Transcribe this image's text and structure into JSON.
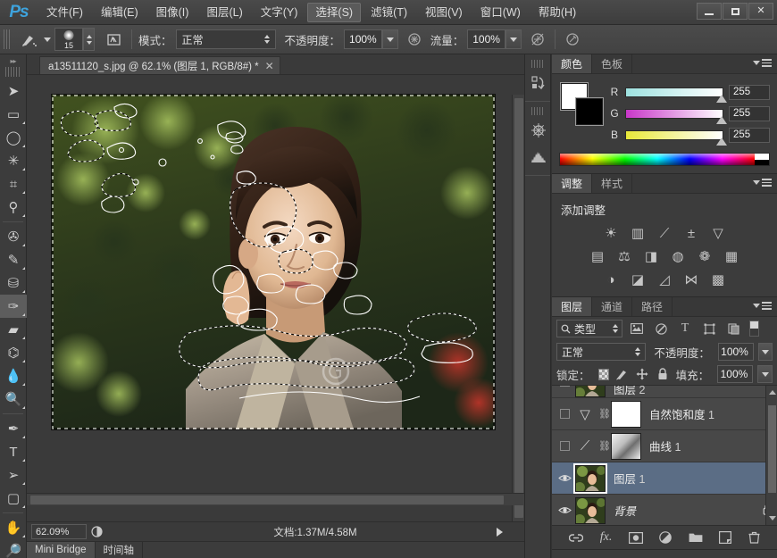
{
  "app": {
    "logo": "Ps",
    "menus": [
      {
        "label": "文件(F)",
        "active": false
      },
      {
        "label": "编辑(E)",
        "active": false
      },
      {
        "label": "图像(I)",
        "active": false
      },
      {
        "label": "图层(L)",
        "active": false
      },
      {
        "label": "文字(Y)",
        "active": false
      },
      {
        "label": "选择(S)",
        "active": true
      },
      {
        "label": "滤镜(T)",
        "active": false
      },
      {
        "label": "视图(V)",
        "active": false
      },
      {
        "label": "窗口(W)",
        "active": false
      },
      {
        "label": "帮助(H)",
        "active": false
      }
    ],
    "window_controls": {
      "minimize": "minimize-icon",
      "maximize": "maximize-icon",
      "close": "✕"
    }
  },
  "options_bar": {
    "tool_icon": "history-brush-icon",
    "brush_size": "15",
    "brush_panel_icon": "brush-panel-icon",
    "mode_label": "模式：",
    "mode_value": "正常",
    "opacity_label": "不透明度：",
    "opacity_value": "100%",
    "opacity_pressure_icon": "pressure-opacity-icon",
    "flow_label": "流量：",
    "flow_value": "100%",
    "airbrush_icon": "airbrush-icon",
    "flow_pressure_icon": "pressure-flow-icon"
  },
  "toolbar": {
    "collapse_icon": "double-chevron-right-icon",
    "groups": [
      [
        {
          "name": "move-tool",
          "glyph": "➤",
          "selected": false,
          "corner": false
        },
        {
          "name": "rectangular-marquee-tool",
          "glyph": "▭",
          "selected": false,
          "corner": true
        },
        {
          "name": "lasso-tool",
          "glyph": "◯",
          "selected": false,
          "corner": true
        },
        {
          "name": "magic-wand-tool",
          "glyph": "✳",
          "selected": false,
          "corner": true
        },
        {
          "name": "crop-tool",
          "glyph": "⌗",
          "selected": false,
          "corner": true
        },
        {
          "name": "eyedropper-tool",
          "glyph": "⚲",
          "selected": false,
          "corner": true
        }
      ],
      [
        {
          "name": "spot-healing-brush-tool",
          "glyph": "✇",
          "selected": false,
          "corner": true
        },
        {
          "name": "brush-tool",
          "glyph": "✎",
          "selected": false,
          "corner": true
        },
        {
          "name": "clone-stamp-tool",
          "glyph": "⛁",
          "selected": false,
          "corner": true
        },
        {
          "name": "history-brush-tool",
          "glyph": "✑",
          "selected": true,
          "corner": true
        },
        {
          "name": "eraser-tool",
          "glyph": "▰",
          "selected": false,
          "corner": true
        },
        {
          "name": "paint-bucket-tool",
          "glyph": "⌬",
          "selected": false,
          "corner": true
        },
        {
          "name": "blur-tool",
          "glyph": "💧",
          "selected": false,
          "corner": true
        },
        {
          "name": "dodge-tool",
          "glyph": "🔍",
          "selected": false,
          "corner": true
        }
      ],
      [
        {
          "name": "pen-tool",
          "glyph": "✒",
          "selected": false,
          "corner": true
        },
        {
          "name": "horizontal-type-tool",
          "glyph": "T",
          "selected": false,
          "corner": true
        },
        {
          "name": "path-selection-tool",
          "glyph": "➢",
          "selected": false,
          "corner": true
        },
        {
          "name": "rectangle-shape-tool",
          "glyph": "▢",
          "selected": false,
          "corner": true
        }
      ],
      [
        {
          "name": "hand-tool",
          "glyph": "✋",
          "selected": false,
          "corner": true
        },
        {
          "name": "zoom-tool",
          "glyph": "🔎",
          "selected": false,
          "corner": false
        }
      ]
    ]
  },
  "document": {
    "tab_title": "a13511120_s.jpg @ 62.1% (图层 1, RGB/8#) *",
    "tab_close": "✕",
    "status": {
      "zoom": "62.09%",
      "preview_icon": "preview-mode-icon",
      "doc_info": "文档:1.37M/4.58M",
      "expand_icon": "play-arrow-icon"
    },
    "bottom_tabs": [
      {
        "label": "Mini Bridge",
        "active": true
      },
      {
        "label": "时间轴",
        "active": false
      }
    ]
  },
  "mini_dock": {
    "items": [
      {
        "name": "history-panel-icon",
        "glyph": "↻"
      },
      {
        "name": "kuler-panel-icon",
        "glyph": "✺"
      },
      {
        "name": "histogram-panel-icon",
        "glyph": "▁▄█"
      }
    ]
  },
  "color_panel": {
    "tabs": [
      {
        "label": "颜色",
        "active": true
      },
      {
        "label": "色板",
        "active": false
      }
    ],
    "menu_icon": "panel-menu-icon",
    "foreground_color": "#ffffff",
    "background_color": "#000000",
    "channels": [
      {
        "label": "R",
        "value": "255"
      },
      {
        "label": "G",
        "value": "255"
      },
      {
        "label": "B",
        "value": "255"
      }
    ]
  },
  "adjustments_panel": {
    "tabs": [
      {
        "label": "调整",
        "active": true
      },
      {
        "label": "样式",
        "active": false
      }
    ],
    "menu_icon": "panel-menu-icon",
    "title": "添加调整",
    "rows": [
      [
        {
          "name": "brightness-contrast-icon",
          "glyph": "☀"
        },
        {
          "name": "levels-icon",
          "glyph": "▥"
        },
        {
          "name": "curves-icon",
          "glyph": "⟋"
        },
        {
          "name": "exposure-icon",
          "glyph": "±"
        },
        {
          "name": "vibrance-icon",
          "glyph": "▽"
        }
      ],
      [
        {
          "name": "hue-saturation-icon",
          "glyph": "▤"
        },
        {
          "name": "color-balance-icon",
          "glyph": "⚖"
        },
        {
          "name": "black-white-icon",
          "glyph": "◨"
        },
        {
          "name": "photo-filter-icon",
          "glyph": "◍"
        },
        {
          "name": "channel-mixer-icon",
          "glyph": "❁"
        },
        {
          "name": "color-lookup-icon",
          "glyph": "▦"
        }
      ],
      [
        {
          "name": "invert-icon",
          "glyph": "◑"
        },
        {
          "name": "posterize-icon",
          "glyph": "◪"
        },
        {
          "name": "threshold-icon",
          "glyph": "◿"
        },
        {
          "name": "selective-color-icon",
          "glyph": "⋈"
        },
        {
          "name": "gradient-map-icon",
          "glyph": "▩"
        }
      ]
    ]
  },
  "layers_panel": {
    "tabs": [
      {
        "label": "图层",
        "active": true
      },
      {
        "label": "通道",
        "active": false
      },
      {
        "label": "路径",
        "active": false
      }
    ],
    "menu_icon": "panel-menu-icon",
    "filter": {
      "search_icon": "search-icon",
      "kind": "类型",
      "icons": [
        {
          "name": "filter-pixel-icon",
          "glyph": "▨"
        },
        {
          "name": "filter-adjustment-icon",
          "glyph": "◐"
        },
        {
          "name": "filter-type-icon",
          "glyph": "T"
        },
        {
          "name": "filter-shape-icon",
          "glyph": "⬚"
        },
        {
          "name": "filter-smart-object-icon",
          "glyph": "❏"
        }
      ],
      "toggle_name": "filter-enable-toggle"
    },
    "blend_mode": "正常",
    "opacity_label": "不透明度：",
    "opacity_value": "100%",
    "lock_label": "锁定：",
    "lock_icons": [
      {
        "name": "lock-transparency-icon",
        "glyph": "▨"
      },
      {
        "name": "lock-image-icon",
        "glyph": "✎"
      },
      {
        "name": "lock-position-icon",
        "glyph": "✥"
      },
      {
        "name": "lock-all-icon",
        "glyph": "🔒"
      }
    ],
    "fill_label": "填充：",
    "fill_value": "100%",
    "layers": [
      {
        "name": "图层",
        "index": "2",
        "type": "pixel",
        "visible": false,
        "selected": false,
        "locked": false,
        "partial": true
      },
      {
        "name": "自然饱和度",
        "index": "1",
        "type": "adjustment",
        "adj_icon": "vibrance-icon",
        "adj_glyph": "▽",
        "visible": false,
        "selected": false,
        "locked": false,
        "mask": "white"
      },
      {
        "name": "曲线",
        "index": "1",
        "type": "adjustment",
        "adj_icon": "curves-icon",
        "adj_glyph": "⟋",
        "visible": false,
        "selected": false,
        "locked": false,
        "mask": "image"
      },
      {
        "name": "图层",
        "index": "1",
        "type": "pixel",
        "visible": true,
        "selected": true,
        "locked": false
      },
      {
        "name": "背景",
        "index": "",
        "type": "pixel",
        "visible": true,
        "selected": false,
        "locked": true
      }
    ],
    "footer_icons": [
      {
        "name": "link-layers-icon",
        "glyph": "⛓"
      },
      {
        "name": "layer-style-icon",
        "glyph": "fx"
      },
      {
        "name": "add-layer-mask-icon",
        "glyph": "◉"
      },
      {
        "name": "new-adjustment-layer-icon",
        "glyph": "◑"
      },
      {
        "name": "new-group-icon",
        "glyph": "🗀"
      },
      {
        "name": "new-layer-icon",
        "glyph": "❐"
      },
      {
        "name": "delete-layer-icon",
        "glyph": "🗑"
      }
    ]
  }
}
